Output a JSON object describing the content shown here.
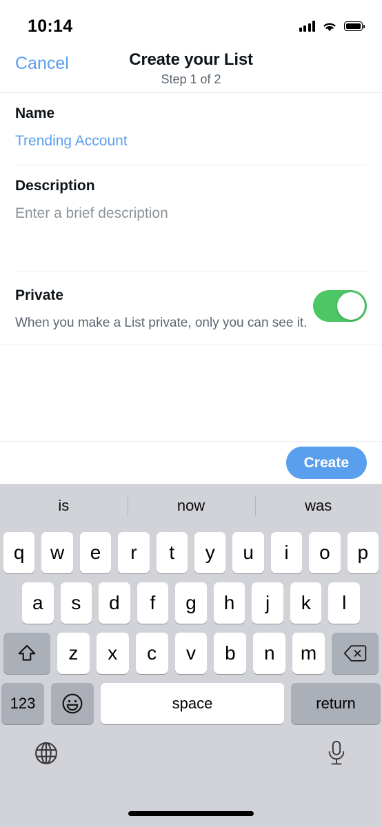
{
  "status_bar": {
    "time": "10:14",
    "signal_icon": "cellular-signal-icon",
    "wifi_icon": "wifi-icon",
    "battery_icon": "battery-full-icon"
  },
  "navbar": {
    "cancel_label": "Cancel",
    "title": "Create your List",
    "subtitle": "Step 1 of 2"
  },
  "form": {
    "name": {
      "label": "Name",
      "value": "Trending Account"
    },
    "description": {
      "label": "Description",
      "placeholder": "Enter a brief description",
      "value": ""
    },
    "private": {
      "label": "Private",
      "description": "When you make a List private, only you can see it.",
      "enabled": true,
      "on_color": "#4CC764"
    }
  },
  "actions": {
    "create_label": "Create",
    "create_color": "#5A9FED"
  },
  "keyboard": {
    "suggestions": [
      "is",
      "now",
      "was"
    ],
    "row1": [
      "q",
      "w",
      "e",
      "r",
      "t",
      "y",
      "u",
      "i",
      "o",
      "p"
    ],
    "row2": [
      "a",
      "s",
      "d",
      "f",
      "g",
      "h",
      "j",
      "k",
      "l"
    ],
    "row3": [
      "z",
      "x",
      "c",
      "v",
      "b",
      "n",
      "m"
    ],
    "shift_icon": "shift-arrow-icon",
    "backspace_icon": "backspace-delete-icon",
    "numbers_label": "123",
    "emoji_icon": "emoji-smiley-icon",
    "space_label": "space",
    "return_label": "return",
    "globe_icon": "globe-language-icon",
    "dictation_icon": "microphone-icon",
    "background_color": "#D1D3D9"
  }
}
